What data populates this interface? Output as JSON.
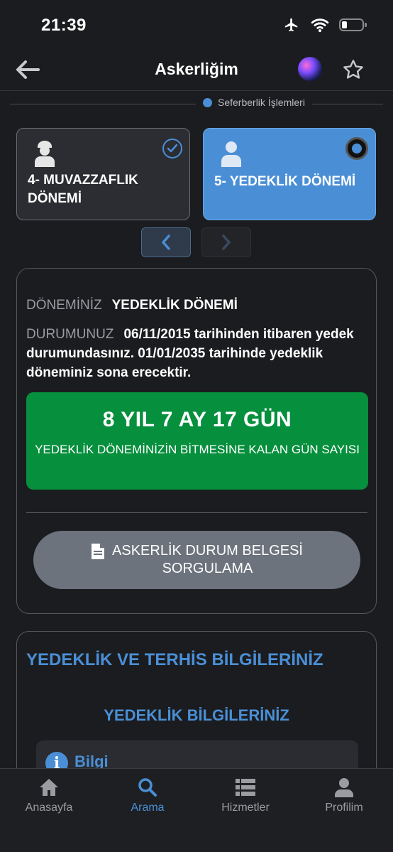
{
  "status": {
    "time": "21:39"
  },
  "nav": {
    "title": "Askerliğim"
  },
  "separator": {
    "label": "Seferberlik İşlemleri"
  },
  "periods": [
    {
      "label_line1": "4- MUVAZZAFLIK",
      "label_line2": "DÖNEMİ",
      "state": "completed"
    },
    {
      "label_line1": "5- YEDEKLİK DÖNEMİ",
      "state": "selected"
    }
  ],
  "info": {
    "period_label": "DÖNEMİNİZ",
    "period_value": "YEDEKLİK DÖNEMİ",
    "status_label": "DURUMUNUZ",
    "status_value": "06/11/2015 tarihinden itibaren yedek durumundasınız. 01/01/2035 tarihinde yedeklik döneminiz sona erecektir.",
    "remaining_big": "8 YIL 7 AY 17 GÜN",
    "remaining_small": "YEDEKLİK DÖNEMİNİZİN BİTMESİNE KALAN GÜN SAYISI",
    "doc_button_line1": "ASKERLİK DURUM BELGESİ",
    "doc_button_line2": "SORGULAMA"
  },
  "section2": {
    "title": "YEDEKLİK VE TERHİS BİLGİLERİNİZ",
    "subtitle": "YEDEKLİK BİLGİLERİNİZ",
    "info_label": "Bilgi"
  },
  "tabs": [
    {
      "label": "Anasayfa",
      "icon": "home-icon",
      "active": false
    },
    {
      "label": "Arama",
      "icon": "search-icon",
      "active": true
    },
    {
      "label": "Hizmetler",
      "icon": "list-icon",
      "active": false
    },
    {
      "label": "Profilim",
      "icon": "person-icon",
      "active": false
    }
  ],
  "colors": {
    "accent": "#4a8fd6",
    "success": "#068f3c",
    "background": "#1b1c1f"
  }
}
